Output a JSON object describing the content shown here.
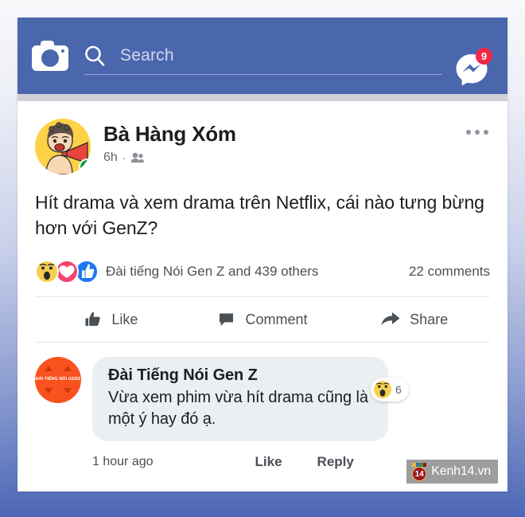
{
  "theme": {
    "header_blue": "#4a67ad",
    "page_gradient_top": "#f7f8fa",
    "page_gradient_bottom": "#4c67b6",
    "like_blue": "#2078f4",
    "love_red": "#f4436c",
    "wow_yellow": "#f7d04e",
    "badge_red": "#f02849",
    "online_green": "#0f9d2e",
    "comment_bubble": "#eceff1",
    "comment_avatar_orange": "#f9521e"
  },
  "header": {
    "camera_icon": "camera-icon",
    "search_icon": "search-icon",
    "search_value": "",
    "search_placeholder": "Search",
    "messenger_icon": "messenger-icon",
    "messenger_badge": "9"
  },
  "post": {
    "author": "Bà Hàng Xóm",
    "avatar_alt": "cartoon-woman-with-megaphone",
    "timestamp": "6h",
    "separator": "·",
    "audience_icon": "friends-icon",
    "more_icon": "more-options-icon",
    "text": "Hít drama và xem drama trên Netflix, cái nào tưng bừng hơn với GenZ?",
    "reactions": [
      {
        "name": "wow",
        "color": "#f7d04e"
      },
      {
        "name": "love",
        "color": "#f4436c"
      },
      {
        "name": "like",
        "color": "#2078f4"
      }
    ],
    "reaction_summary": "Đài tiếng Nói Gen Z and 439 others",
    "comments_count": "22 comments",
    "actions": [
      {
        "icon": "thumbs-up-icon",
        "label": "Like"
      },
      {
        "icon": "comment-bubble-icon",
        "label": "Comment"
      },
      {
        "icon": "share-arrow-icon",
        "label": "Share"
      }
    ]
  },
  "comment": {
    "avatar_text": "ĐÀI TIẾNG NÓI GENZ",
    "author": "Đài Tiếng Nói Gen Z",
    "text": "Vừa xem phim vừa hít drama cũng là một ý hay đó ạ.",
    "reaction_icon": "wow",
    "reaction_count": "6",
    "timestamp": "1 hour ago",
    "like_label": "Like",
    "reply_label": "Reply"
  },
  "watermark": {
    "logo_number": "14",
    "label": "Kenh14.vn"
  }
}
